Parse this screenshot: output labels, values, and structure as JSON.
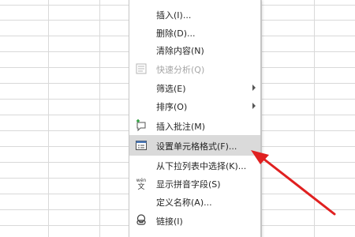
{
  "context_menu": {
    "items": [
      {
        "id": "insert",
        "label": "插入(I)...",
        "disabled": false,
        "submenu": false,
        "icon": ""
      },
      {
        "id": "delete",
        "label": "删除(D)...",
        "disabled": false,
        "submenu": false,
        "icon": ""
      },
      {
        "id": "clear-contents",
        "label": "清除内容(N)",
        "disabled": false,
        "submenu": false,
        "icon": ""
      },
      {
        "id": "quick-analysis",
        "label": "快速分析(Q)",
        "disabled": true,
        "submenu": false,
        "icon": "quick-analysis-icon"
      },
      {
        "id": "filter",
        "label": "筛选(E)",
        "disabled": false,
        "submenu": true,
        "icon": ""
      },
      {
        "id": "sort",
        "label": "排序(O)",
        "disabled": false,
        "submenu": true,
        "icon": ""
      },
      {
        "id": "insert-comment",
        "label": "插入批注(M)",
        "disabled": false,
        "submenu": false,
        "icon": "comment-icon"
      },
      {
        "id": "format-cells",
        "label": "设置单元格格式(F)...",
        "disabled": false,
        "submenu": false,
        "icon": "format-cells-icon",
        "highlighted": true
      },
      {
        "id": "pick-from-list",
        "label": "从下拉列表中选择(K)...",
        "disabled": false,
        "submenu": false,
        "icon": ""
      },
      {
        "id": "show-phonetic",
        "label": "显示拼音字段(S)",
        "disabled": false,
        "submenu": false,
        "icon": "phonetic-icon"
      },
      {
        "id": "define-name",
        "label": "定义名称(A)...",
        "disabled": false,
        "submenu": false,
        "icon": ""
      },
      {
        "id": "link",
        "label": "链接(I)",
        "disabled": false,
        "submenu": false,
        "icon": "link-icon"
      }
    ]
  },
  "phonetic_icon_text": "wén",
  "phonetic_icon_char": "文",
  "colors": {
    "highlight": "#dadada",
    "annotation_arrow": "#e02020",
    "grid_line": "#d4d4d4"
  }
}
